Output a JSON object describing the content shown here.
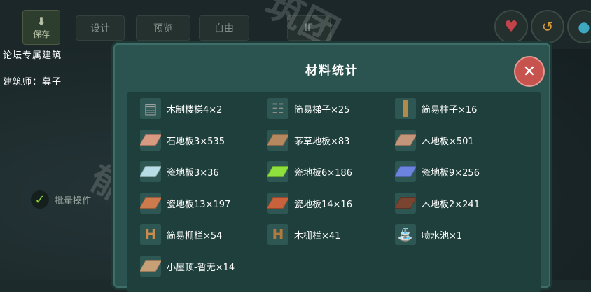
{
  "toolbar": {
    "save_label": "保存",
    "tabs": [
      "设计",
      "预览",
      "自由",
      "IF"
    ]
  },
  "side": {
    "forum_label": "论坛专属建筑",
    "builder_label": "建筑师：募子",
    "batch_label": "批量操作"
  },
  "watermarks": [
    "筑团",
    "郁金香建筑"
  ],
  "dialog": {
    "title": "材料统计",
    "close_symbol": "✕"
  },
  "materials": [
    {
      "label": "木制楼梯4×2",
      "icon": "stairs-icon",
      "color": "#9aa0a0"
    },
    {
      "label": "简易梯子×25",
      "icon": "ladder-icon",
      "color": "#8a8f8c"
    },
    {
      "label": "简易柱子×16",
      "icon": "pillar-icon",
      "color": "#b48a4a"
    },
    {
      "label": "石地板3×535",
      "icon": "stone-floor-icon",
      "color": "#d89a80"
    },
    {
      "label": "茅草地板×83",
      "icon": "thatch-floor-icon",
      "color": "#b58860"
    },
    {
      "label": "木地板×501",
      "icon": "wood-floor-icon",
      "color": "#c3957a"
    },
    {
      "label": "瓷地板3×36",
      "icon": "tile-floor-icon",
      "color": "#b8dde6"
    },
    {
      "label": "瓷地板6×186",
      "icon": "tile-floor-icon",
      "color": "#8ee03c"
    },
    {
      "label": "瓷地板9×256",
      "icon": "tile-floor-icon",
      "color": "#6c84e0"
    },
    {
      "label": "瓷地板13×197",
      "icon": "tile-floor-icon",
      "color": "#cd7a4c"
    },
    {
      "label": "瓷地板14×16",
      "icon": "tile-floor-icon",
      "color": "#c8623c"
    },
    {
      "label": "木地板2×241",
      "icon": "wood-floor-icon",
      "color": "#7a4530"
    },
    {
      "label": "简易栅栏×54",
      "icon": "fence-icon",
      "color": "#c98c4c"
    },
    {
      "label": "木栅栏×41",
      "icon": "fence-icon",
      "color": "#b27a40"
    },
    {
      "label": "喷水池×1",
      "icon": "fountain-icon",
      "color": "#cfe6ee"
    },
    {
      "label": "小屋顶-暂无×14",
      "icon": "roof-icon",
      "color": "#c8a078"
    }
  ]
}
